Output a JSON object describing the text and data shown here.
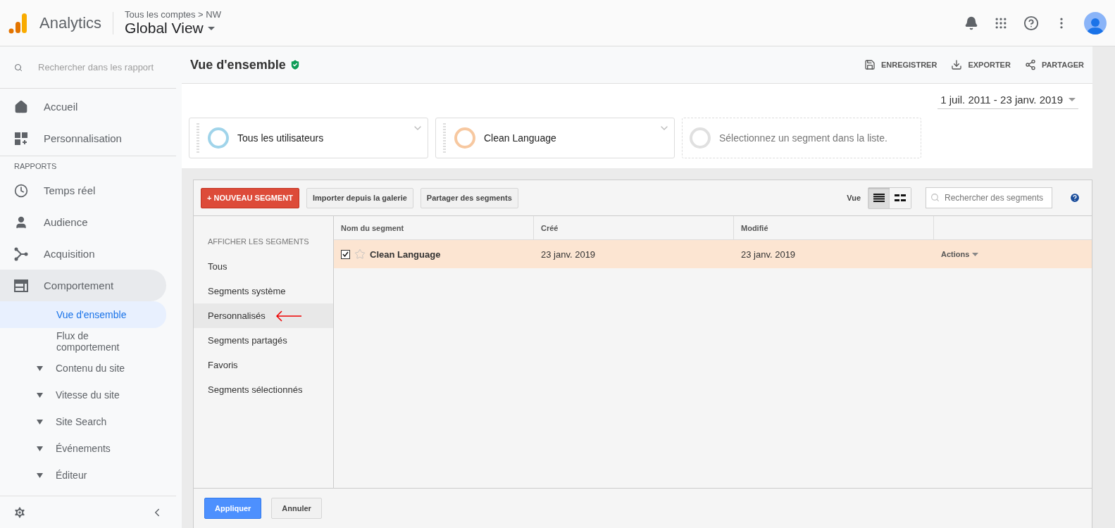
{
  "header": {
    "product": "Analytics",
    "breadcrumb": "Tous les comptes > NW",
    "view_title": "Global View"
  },
  "sidebar": {
    "search_placeholder": "Rechercher dans les rapport",
    "top_items": [
      {
        "label": "Accueil"
      },
      {
        "label": "Personnalisation"
      }
    ],
    "section_label": "RAPPORTS",
    "report_items": [
      {
        "label": "Temps réel",
        "expanded": false
      },
      {
        "label": "Audience",
        "expanded": false
      },
      {
        "label": "Acquisition",
        "expanded": false
      },
      {
        "label": "Comportement",
        "expanded": true,
        "children": [
          {
            "label": "Vue d'ensemble",
            "kind": "page",
            "selected": true
          },
          {
            "label": "Flux de comportement",
            "kind": "page",
            "selected": false
          },
          {
            "label": "Contenu du site",
            "kind": "group",
            "selected": false
          },
          {
            "label": "Vitesse du site",
            "kind": "group",
            "selected": false
          },
          {
            "label": "Site Search",
            "kind": "group",
            "selected": false
          },
          {
            "label": "Événements",
            "kind": "group",
            "selected": false
          },
          {
            "label": "Éditeur",
            "kind": "group",
            "selected": false
          }
        ]
      }
    ]
  },
  "page": {
    "title": "Vue d'ensemble",
    "verified": true,
    "actions": [
      {
        "label": "ENREGISTRER"
      },
      {
        "label": "EXPORTER"
      },
      {
        "label": "PARTAGER"
      }
    ],
    "date_range": "1 juil. 2011 - 23 janv. 2019",
    "segments": [
      {
        "kind": "active",
        "label": "Tous les utilisateurs",
        "color": "#a0d4ea"
      },
      {
        "kind": "active",
        "label": "Clean Language",
        "color": "#f7c8a0"
      },
      {
        "kind": "empty",
        "label": "Sélectionnez un segment dans la liste."
      }
    ]
  },
  "segment_panel": {
    "buttons": [
      {
        "label": "+ NOUVEAU SEGMENT",
        "kind": "primary"
      },
      {
        "label": "Importer depuis la galerie",
        "kind": "default"
      },
      {
        "label": "Partager des segments",
        "kind": "default"
      }
    ],
    "view_label": "Vue",
    "view_options": [
      {
        "kind": "list",
        "selected": true
      },
      {
        "kind": "grid",
        "selected": false
      }
    ],
    "search_placeholder": "Rechercher des segments",
    "filter_heading": "AFFICHER LES SEGMENTS",
    "filters": [
      {
        "label": "Tous",
        "selected": false
      },
      {
        "label": "Segments système",
        "selected": false
      },
      {
        "label": "Personnalisés",
        "selected": true
      },
      {
        "label": "Segments partagés",
        "selected": false
      },
      {
        "label": "Favoris",
        "selected": false
      },
      {
        "label": "Segments sélectionnés",
        "selected": false
      }
    ],
    "table": {
      "columns": [
        "Nom du segment",
        "Créé",
        "Modifié"
      ],
      "rows": [
        {
          "checked": true,
          "starred": false,
          "name": "Clean Language",
          "created": "23 janv. 2019",
          "modified": "23 janv. 2019",
          "action": "Actions"
        }
      ]
    },
    "footer_buttons": [
      {
        "label": "Appliquer",
        "kind": "primary"
      },
      {
        "label": "Annuler",
        "kind": "default"
      }
    ]
  }
}
